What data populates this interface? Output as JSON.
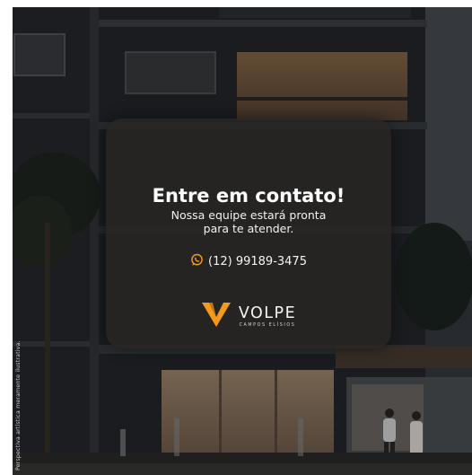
{
  "contact": {
    "headline": "Entre em contato!",
    "subline": "Nossa equipe estará pronta para te atender.",
    "phone": "(12) 99189-3475",
    "phone_icon": "whatsapp-icon"
  },
  "brand": {
    "name": "VOLPE",
    "subtitle": "CAMPOS ELÍSIOS",
    "logo_icon": "volpe-chevron-logo-icon"
  },
  "disclaimer": "Perspectiva artística meramente ilustrativa.",
  "colors": {
    "brand_orange": "#f39a1d",
    "whatsapp_orange": "#f39a1d",
    "card_bg": "#282624"
  }
}
